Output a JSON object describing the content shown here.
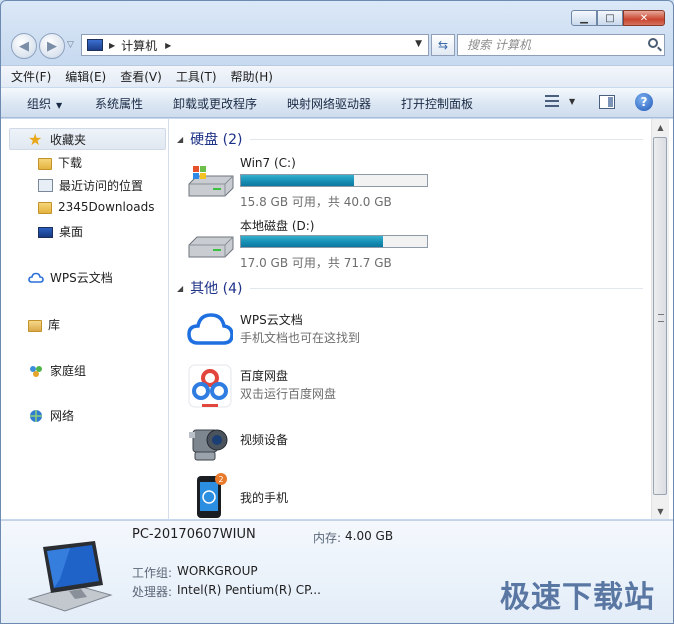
{
  "nav": {
    "breadcrumb": "计算机",
    "search_placeholder": "搜索 计算机"
  },
  "menu": [
    "文件(F)",
    "编辑(E)",
    "查看(V)",
    "工具(T)",
    "帮助(H)"
  ],
  "toolbar": {
    "organize": "组织",
    "system_properties": "系统属性",
    "uninstall": "卸载或更改程序",
    "map_drive": "映射网络驱动器",
    "control_panel": "打开控制面板"
  },
  "sidebar": {
    "favorites": "收藏夹",
    "downloads": "下载",
    "recent": "最近访问的位置",
    "folder2345": "2345Downloads",
    "desktop": "桌面",
    "wps": "WPS云文档",
    "library": "库",
    "homegroup": "家庭组",
    "network": "网络"
  },
  "groups": {
    "hdd": "硬盘 (2)",
    "other": "其他 (4)"
  },
  "drives": [
    {
      "name": "Win7 (C:)",
      "info": "15.8 GB 可用，共 40.0 GB",
      "used_fraction": 0.605
    },
    {
      "name": "本地磁盘 (D:)",
      "info": "17.0 GB 可用，共 71.7 GB",
      "used_fraction": 0.763
    }
  ],
  "others": [
    {
      "name": "WPS云文档",
      "sub": "手机文档也可在这找到"
    },
    {
      "name": "百度网盘",
      "sub": "双击运行百度网盘"
    },
    {
      "name": "视频设备",
      "sub": ""
    },
    {
      "name": "我的手机",
      "sub": ""
    }
  ],
  "details": {
    "pc_name": "PC-20170607WIUN",
    "memory_label": "内存:",
    "memory_value": "4.00 GB",
    "workgroup_label": "工作组:",
    "workgroup_value": "WORKGROUP",
    "cpu_label": "处理器:",
    "cpu_value": "Intel(R) Pentium(R) CP..."
  },
  "watermark": "极速下载站",
  "colors": {
    "drive_fill": "#168fb5",
    "group_header": "#1e3287",
    "accent": "#2a4f86"
  }
}
